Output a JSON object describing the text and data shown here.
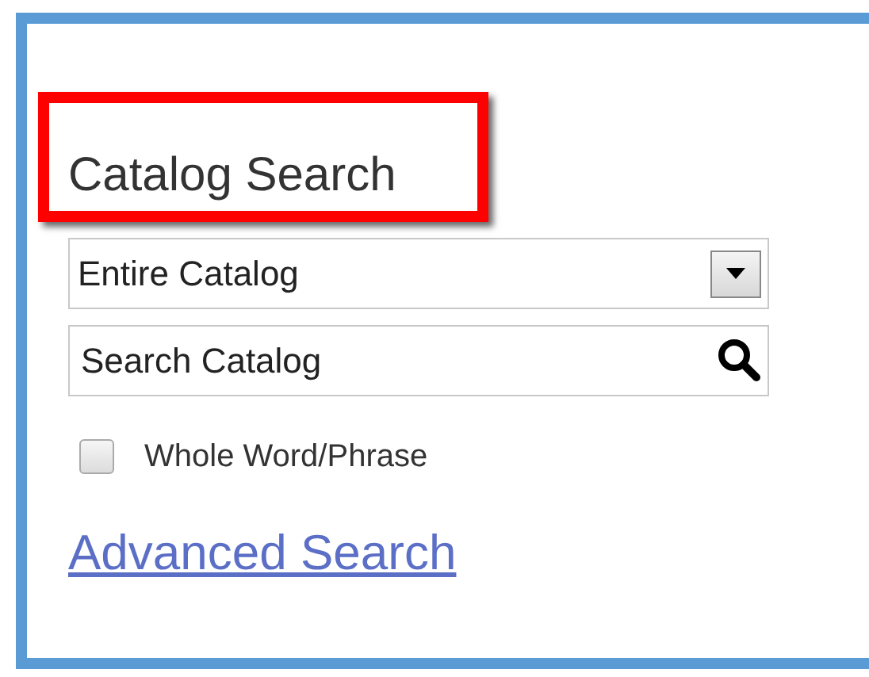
{
  "heading": "Catalog Search",
  "scope_select": {
    "value": "Entire Catalog"
  },
  "search": {
    "placeholder": "Search Catalog"
  },
  "whole_word": {
    "label": "Whole Word/Phrase",
    "checked": false
  },
  "advanced_link": "Advanced Search"
}
